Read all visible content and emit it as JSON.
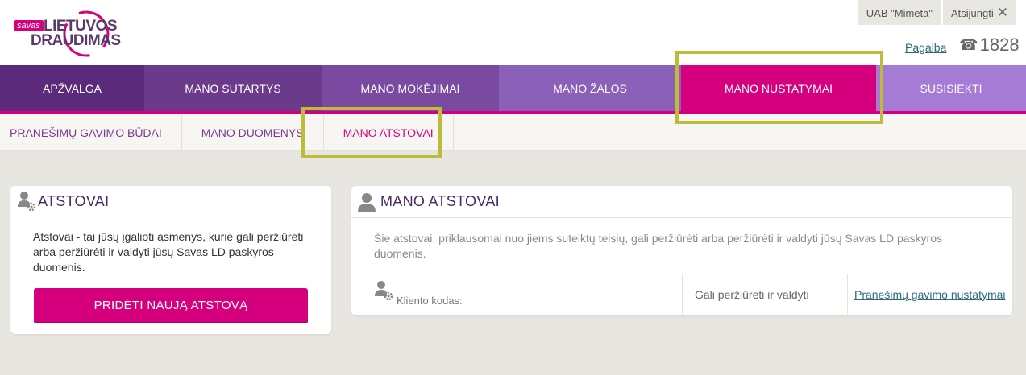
{
  "header": {
    "logo": {
      "badge": "savas",
      "line1": "LIETUVOS",
      "line2": "DRAUDIMAS"
    },
    "company": "UAB \"Mimeta\"",
    "logout": "Atsijungti",
    "help": "Pagalba",
    "phone": "1828"
  },
  "main_nav": [
    {
      "label": "APŽVALGA",
      "color": "#5b2a7a"
    },
    {
      "label": "MANO SUTARTYS",
      "color": "#6c3a8a"
    },
    {
      "label": "MANO MOKĖJIMAI",
      "color": "#7a4aa0"
    },
    {
      "label": "MANO ŽALOS",
      "color": "#8a60b8"
    },
    {
      "label": "MANO NUSTATYMAI",
      "color": "#d6007f",
      "active": true
    },
    {
      "label": "SUSISIEKTI",
      "color": "#a57bd6"
    }
  ],
  "sub_nav": [
    {
      "label": "PRANEŠIMŲ GAVIMO BŪDAI"
    },
    {
      "label": "MANO DUOMENYS"
    },
    {
      "label": "MANO ATSTOVAI",
      "active": true
    }
  ],
  "left_card": {
    "title": "ATSTOVAI",
    "description": "Atstovai - tai jūsų įgalioti asmenys, kurie gali peržiūrėti arba peržiūrėti ir valdyti jūsų Savas LD paskyros duomenis.",
    "button": "PRIDĖTI NAUJĄ ATSTOVĄ"
  },
  "right_card": {
    "title": "MANO ATSTOVAI",
    "description": "Šie atstovai, priklausomai nuo jiems suteiktų teisių, gali peržiūrėti arba peržiūrėti ir valdyti jūsų Savas LD paskyros duomenis.",
    "row": {
      "client_code_label": "Kliento kodas:",
      "permission": "Gali peržiūrėti ir valdyti",
      "link": "Pranešimų gavimo nustatymai"
    }
  },
  "colors": {
    "accent": "#d6007f",
    "highlight": "#bdbb3a",
    "brand": "#5a3a6b"
  }
}
